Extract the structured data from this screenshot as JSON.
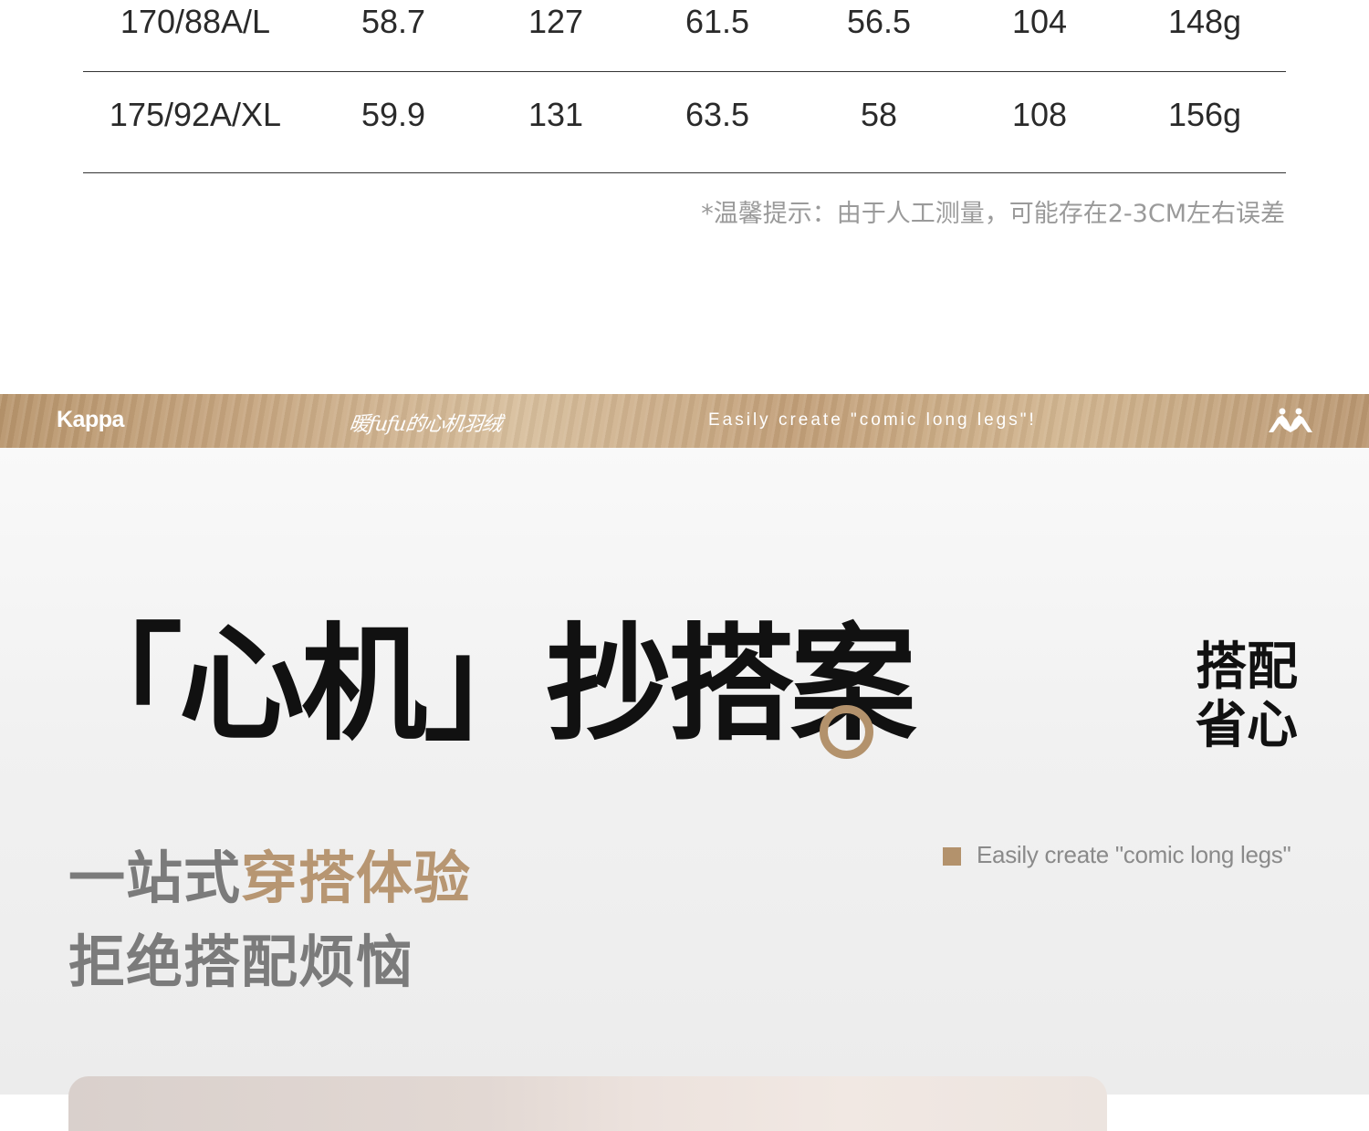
{
  "size_table": {
    "rows": [
      [
        "170/88A/L",
        "58.7",
        "127",
        "61.5",
        "56.5",
        "104",
        "148g"
      ],
      [
        "175/92A/XL",
        "59.9",
        "131",
        "63.5",
        "58",
        "108",
        "156g"
      ]
    ]
  },
  "tip": "*温馨提示：由于人工测量，可能存在2-3CM左右误差",
  "banner": {
    "logo_text": "Kappa",
    "slogan": "暖fufu的心机羽绒",
    "tagline": "Easily create \"comic long legs\"!",
    "brand_icon": "omini-logo-icon",
    "colors": {
      "banner": "#c6a57f",
      "text": "#ffffff"
    }
  },
  "headline": {
    "title": "「心机」抄搭案",
    "side_title": "搭配省心",
    "sub_line1_plain": "一站式",
    "sub_line1_accent": "穿搭体验",
    "sub_line2": "拒绝搭配烦恼",
    "bullet_text": "Easily create \"comic long legs\"",
    "colors": {
      "accent": "#b3926c",
      "title": "#111111",
      "subtitle": "#7b7b7b"
    }
  }
}
